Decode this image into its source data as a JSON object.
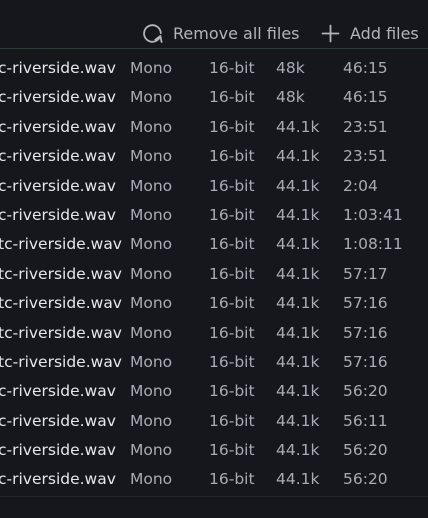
{
  "toolbar": {
    "remove_all_label": "Remove all files",
    "add_files_label": "Add files"
  },
  "icons": {
    "remove_all": "refresh-icon",
    "add_files": "plus-icon"
  },
  "colors": {
    "background": "#16171c",
    "filename_text": "#e6e7ea",
    "meta_text": "#a9acb5"
  },
  "files": [
    {
      "name": "c-riverside.wav",
      "channels": "Mono",
      "bit_depth": "16-bit",
      "sample_rate": "48k",
      "duration": "46:15"
    },
    {
      "name": "c-riverside.wav",
      "channels": "Mono",
      "bit_depth": "16-bit",
      "sample_rate": "48k",
      "duration": "46:15"
    },
    {
      "name": "c-riverside.wav",
      "channels": "Mono",
      "bit_depth": "16-bit",
      "sample_rate": "44.1k",
      "duration": "23:51"
    },
    {
      "name": "c-riverside.wav",
      "channels": "Mono",
      "bit_depth": "16-bit",
      "sample_rate": "44.1k",
      "duration": "23:51"
    },
    {
      "name": "c-riverside.wav",
      "channels": "Mono",
      "bit_depth": "16-bit",
      "sample_rate": "44.1k",
      "duration": "2:04"
    },
    {
      "name": "c-riverside.wav",
      "channels": "Mono",
      "bit_depth": "16-bit",
      "sample_rate": "44.1k",
      "duration": "1:03:41"
    },
    {
      "name": "tc-riverside.wav",
      "channels": "Mono",
      "bit_depth": "16-bit",
      "sample_rate": "44.1k",
      "duration": "1:08:11"
    },
    {
      "name": "tc-riverside.wav",
      "channels": "Mono",
      "bit_depth": "16-bit",
      "sample_rate": "44.1k",
      "duration": "57:17"
    },
    {
      "name": "tc-riverside.wav",
      "channels": "Mono",
      "bit_depth": "16-bit",
      "sample_rate": "44.1k",
      "duration": "57:16"
    },
    {
      "name": "tc-riverside.wav",
      "channels": "Mono",
      "bit_depth": "16-bit",
      "sample_rate": "44.1k",
      "duration": "57:16"
    },
    {
      "name": "tc-riverside.wav",
      "channels": "Mono",
      "bit_depth": "16-bit",
      "sample_rate": "44.1k",
      "duration": "57:16"
    },
    {
      "name": "c-riverside.wav",
      "channels": "Mono",
      "bit_depth": "16-bit",
      "sample_rate": "44.1k",
      "duration": "56:20"
    },
    {
      "name": "c-riverside.wav",
      "channels": "Mono",
      "bit_depth": "16-bit",
      "sample_rate": "44.1k",
      "duration": "56:11"
    },
    {
      "name": "c-riverside.wav",
      "channels": "Mono",
      "bit_depth": "16-bit",
      "sample_rate": "44.1k",
      "duration": "56:20"
    },
    {
      "name": "c-riverside.wav",
      "channels": "Mono",
      "bit_depth": "16-bit",
      "sample_rate": "44.1k",
      "duration": "56:20"
    }
  ]
}
